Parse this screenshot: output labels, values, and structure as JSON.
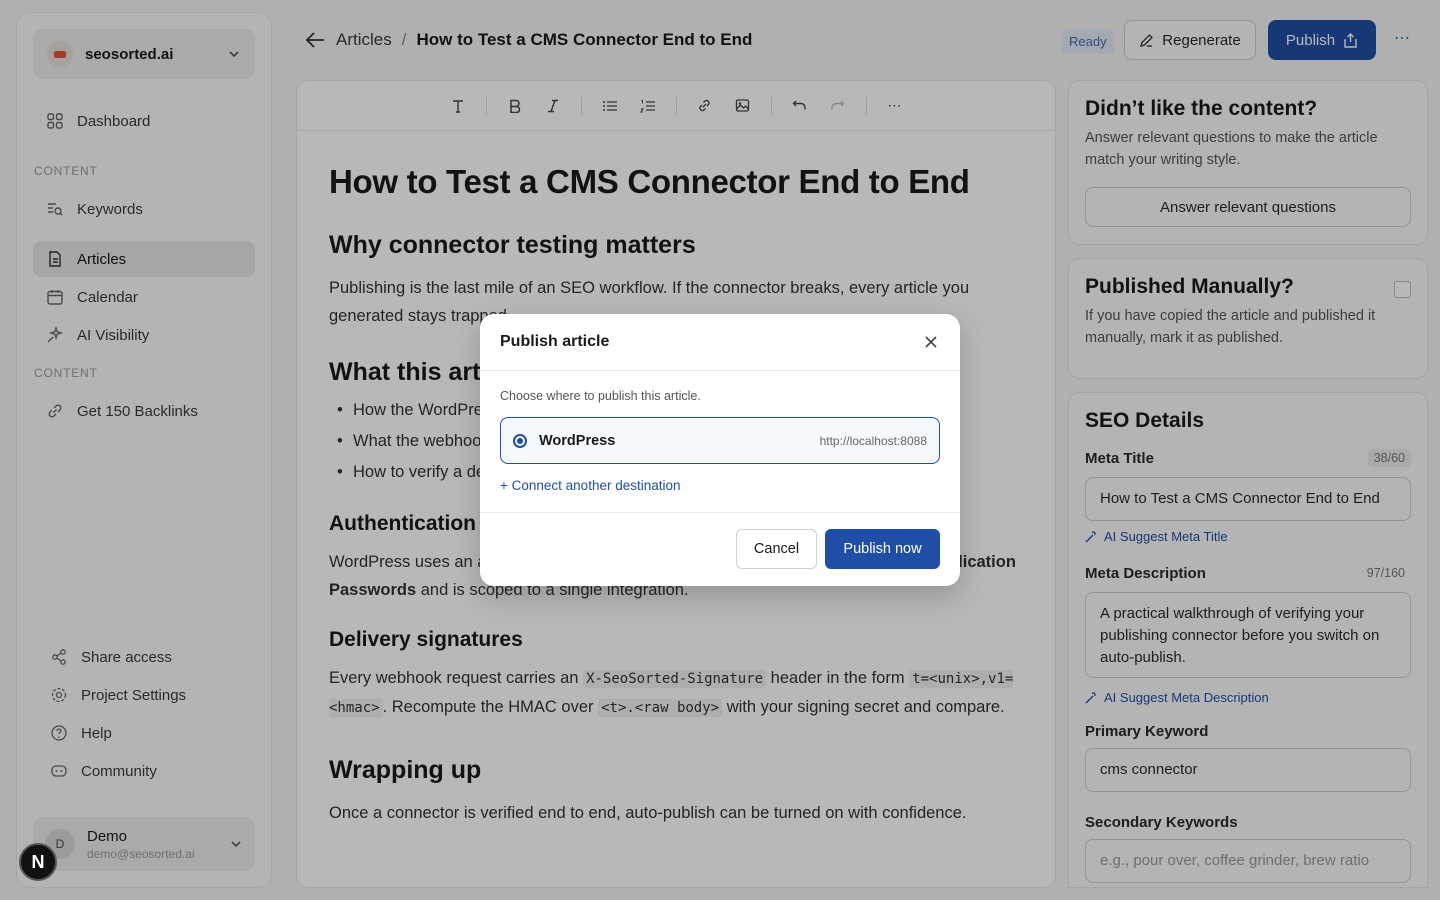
{
  "workspace": {
    "name": "seosorted.ai"
  },
  "sidebar": {
    "items": [
      {
        "label": "Dashboard",
        "icon": "grid-icon"
      },
      {
        "label": "Keywords",
        "icon": "list-search-icon"
      },
      {
        "label": "Articles",
        "icon": "document-icon",
        "active": true
      },
      {
        "label": "Calendar",
        "icon": "calendar-icon"
      },
      {
        "label": "AI Visibility",
        "icon": "sparkle-icon"
      },
      {
        "label": "Get 150 Backlinks",
        "icon": "link-icon"
      }
    ],
    "sections": [
      "CONTENT",
      "CONTENT"
    ],
    "bottom_items": [
      {
        "label": "Share access",
        "icon": "share-icon"
      },
      {
        "label": "Project Settings",
        "icon": "gear-icon"
      },
      {
        "label": "Help",
        "icon": "help-icon"
      },
      {
        "label": "Community",
        "icon": "discord-icon"
      }
    ],
    "user": {
      "initial": "D",
      "name": "Demo",
      "email": "demo@seosorted.ai"
    },
    "badge": "N"
  },
  "header": {
    "breadcrumb_root": "Articles",
    "breadcrumb_sep": "/",
    "breadcrumb_current": "How to Test a CMS Connector End to End",
    "status": "Ready",
    "regenerate_label": "Regenerate",
    "publish_label": "Publish",
    "more": "⋯"
  },
  "article": {
    "title": "How to Test a CMS Connector End to End",
    "h_why": "Why connector testing matters",
    "p_why": "Publishing is the last mile of an SEO workflow. If the connector breaks, every article you generated stays trapped.",
    "h_what": "What this article covers",
    "bullets": [
      "How the WordPress connector authenticates",
      "What the webhook delivery signature looks like",
      "How to verify a delivery end to end"
    ],
    "h_auth": "Authentication",
    "p_auth_1": "WordPress uses an application password that is generated in",
    "p_auth_bold": "Users -> Profile -> Application Passwords",
    "p_auth_2": "and is scoped to a single integration.",
    "h_sig": "Delivery signatures",
    "p_sig_1": "Every webhook request carries an",
    "code_header": "X-SeoSorted-Signature",
    "p_sig_2": "header in the form",
    "code_form": "t=<unix>,v1=<hmac>",
    "p_sig_3": ". Recompute the HMAC over",
    "code_body": "<t>.<raw body>",
    "p_sig_4": "with your signing secret and compare.",
    "h_wrap": "Wrapping up",
    "p_wrap": "Once a connector is verified end to end, auto-publish can be turned on with confidence."
  },
  "panel": {
    "feedback": {
      "title": "Didn’t like the content?",
      "text": "Answer relevant questions to make the article match your writing style.",
      "button": "Answer relevant questions"
    },
    "manual": {
      "title": "Published Manually?",
      "text": "If you have copied the article and published it manually, mark it as published."
    },
    "seo": {
      "title": "SEO Details",
      "meta_title_label": "Meta Title",
      "meta_title_count": "38/60",
      "meta_title_value": "How to Test a CMS Connector End to End",
      "ai_meta_title": "AI Suggest Meta Title",
      "meta_desc_label": "Meta Description",
      "meta_desc_count": "97/160",
      "meta_desc_value": "A practical walkthrough of verifying your publishing connector before you switch on auto-publish.",
      "ai_meta_desc": "AI Suggest Meta Description",
      "primary_label": "Primary Keyword",
      "primary_value": "cms connector",
      "secondary_label": "Secondary Keywords",
      "secondary_placeholder": "e.g., pour over, coffee grinder, brew ratio"
    }
  },
  "modal": {
    "title": "Publish article",
    "subtitle": "Choose where to publish this article.",
    "destination_name": "WordPress",
    "destination_url": "http://localhost:8088",
    "connect_link": "+ Connect another destination",
    "cancel": "Cancel",
    "confirm": "Publish now"
  },
  "colors": {
    "primary": "#1f4ea6",
    "status_bg": "#e3e9f4",
    "status_text": "#3c6fb3"
  }
}
